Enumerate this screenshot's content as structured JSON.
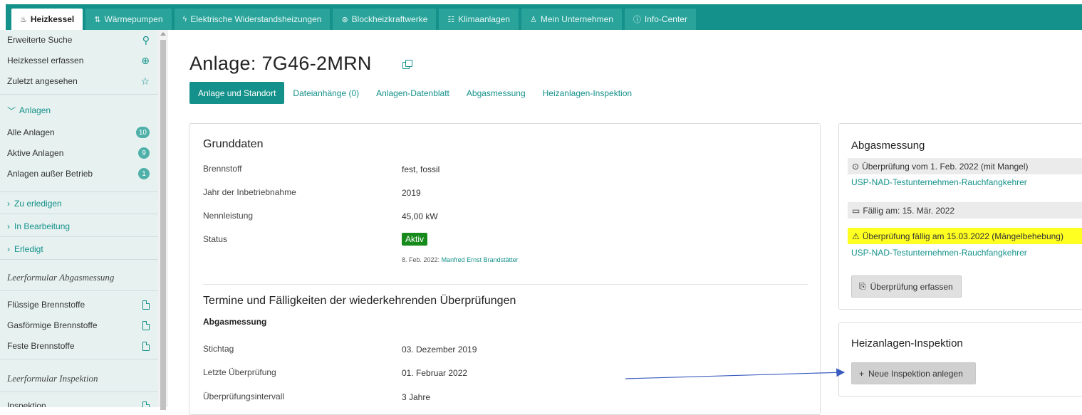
{
  "top_tabs": [
    {
      "label": "Heizkessel",
      "icon": "flame-icon",
      "active": true
    },
    {
      "label": "Wärmepumpen",
      "icon": "heatpump-icon"
    },
    {
      "label": "Elektrische Widerstandsheizungen",
      "icon": "bolt-icon"
    },
    {
      "label": "Blockheizkraftwerke",
      "icon": "plant-icon"
    },
    {
      "label": "Klimaanlagen",
      "icon": "aircon-icon"
    },
    {
      "label": "Mein Unternehmen",
      "icon": "user-icon"
    },
    {
      "label": "Info-Center",
      "icon": "info-icon"
    }
  ],
  "sidebar": {
    "search": "Erweiterte Suche",
    "create": "Heizkessel erfassen",
    "recent": "Zuletzt angesehen",
    "anlagen_section": "Anlagen",
    "all": {
      "label": "Alle Anlagen",
      "count": "10"
    },
    "active": {
      "label": "Aktive Anlagen",
      "count": "9"
    },
    "inactive": {
      "label": "Anlagen außer Betrieb",
      "count": "1"
    },
    "todo": "Zu erledigen",
    "in_progress": "In Bearbeitung",
    "done": "Erledigt",
    "form_abgas_heading": "Leerformular Abgasmessung",
    "liquid": "Flüssige Brennstoffe",
    "gas": "Gasförmige Brennstoffe",
    "solid": "Feste Brennstoffe",
    "form_insp_heading": "Leerformular Inspektion",
    "inspection": "Inspektion"
  },
  "main": {
    "title": "Anlage: 7G46-2MRN",
    "subtabs": [
      "Anlage und Standort",
      "Dateianhänge (0)",
      "Anlagen-Datenblatt",
      "Abgasmessung",
      "Heizanlagen-Inspektion"
    ],
    "grunddaten": {
      "heading": "Grunddaten",
      "fuel_label": "Brennstoff",
      "fuel_value": "fest, fossil",
      "year_label": "Jahr der Inbetriebnahme",
      "year_value": "2019",
      "power_label": "Nennleistung",
      "power_value": "45,00 kW",
      "status_label": "Status",
      "status_value": "Aktiv",
      "status_meta_date": "8. Feb. 2022:",
      "status_meta_user": "Manfred Ernst Brandstätter"
    },
    "termine": {
      "heading": "Termine und Fälligkeiten der wiederkehrenden Überprüfungen",
      "sub_heading": "Abgasmessung",
      "stichtag_label": "Stichtag",
      "stichtag_value": "03. Dezember 2019",
      "last_label": "Letzte Überprüfung",
      "last_value": "01. Februar 2022",
      "interval_label": "Überprüfungsintervall",
      "interval_value": "3 Jahre"
    }
  },
  "right": {
    "abgas": {
      "heading": "Abgasmessung",
      "check": "Überprüfung vom 1. Feb. 2022 (mit Mangel)",
      "company1": "USP-NAD-Testunternehmen-Rauchfangkehrer",
      "due": "Fällig am: 15. Mär. 2022",
      "warning": "Überprüfung fällig am 15.03.2022 (Mängelbehebung)",
      "company2": "USP-NAD-Testunternehmen-Rauchfangkehrer",
      "button": "Überprüfung erfassen"
    },
    "inspektion": {
      "heading": "Heizanlagen-Inspektion",
      "button": "Neue Inspektion anlegen"
    }
  },
  "colors": {
    "accent": "#14918a",
    "status_green": "#178a1c",
    "warning_yellow": "#ffff22",
    "sidebar_bg": "#e6f1f0",
    "arrow": "#3a5cc0"
  }
}
